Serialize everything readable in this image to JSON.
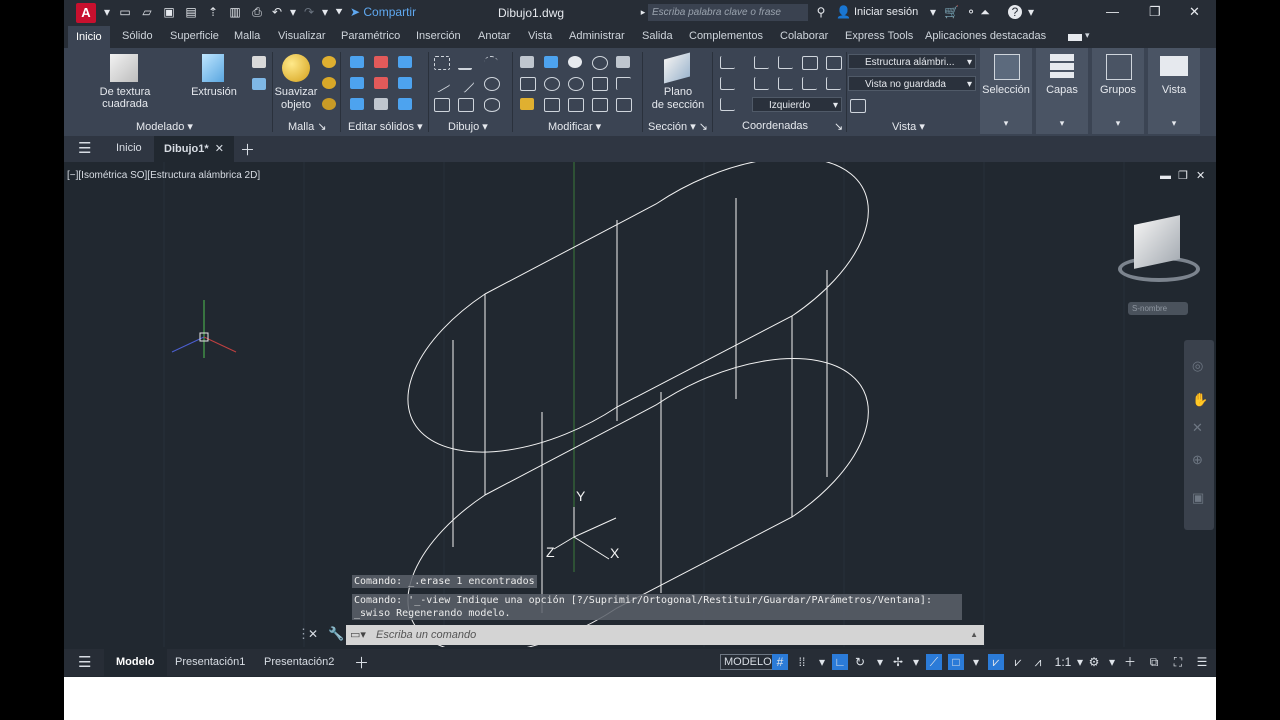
{
  "titlebar": {
    "logo": "A",
    "share_label": "Compartir",
    "doc_title": "Dibujo1.dwg",
    "search_placeholder": "Escriba palabra clave o frase",
    "signin_label": "Iniciar sesión"
  },
  "ribbon_tabs": [
    "Inicio",
    "Sólido",
    "Superficie",
    "Malla",
    "Visualizar",
    "Paramétrico",
    "Inserción",
    "Anotar",
    "Vista",
    "Administrar",
    "Salida",
    "Complementos",
    "Colaborar",
    "Express Tools",
    "Aplicaciones destacadas"
  ],
  "ribbon": {
    "big_buttons": {
      "box": "De textura cuadrada",
      "extrude": "Extrusión",
      "smooth_line1": "Suavizar",
      "smooth_line2": "objeto",
      "section_line1": "Plano",
      "section_line2": "de sección",
      "selection": "Selección",
      "layers": "Capas",
      "groups": "Grupos",
      "view": "Vista"
    },
    "panels": [
      "Modelado",
      "Malla",
      "Editar sólidos",
      "Dibujo",
      "Modificar",
      "Sección",
      "Coordenadas",
      "Vista"
    ],
    "coord_dropdown": "Izquierdo",
    "visual_style": "Estructura alámbri...",
    "named_view": "Vista no guardada"
  },
  "file_tabs": {
    "start": "Inicio",
    "active": "Dibujo1*"
  },
  "viewport": {
    "label": "[−][Isométrica SO][Estructura alámbrica 2D]",
    "viewcube_label": "S-nombre",
    "ucs_y": "Y",
    "ucs_x": "X",
    "ucs_z": "Z"
  },
  "command": {
    "history1": "Comando: _.erase 1 encontrados",
    "history2": "Comando: '_-view Indique una opción [?/Suprimir/Ortogonal/Restituir/Guardar/PArámetros/Ventana]:",
    "history3": "_swiso Regenerando modelo.",
    "placeholder": "Escriba un comando"
  },
  "status": {
    "model_tab": "Modelo",
    "layout1": "Presentación1",
    "layout2": "Presentación2",
    "model_button": "MODELO",
    "scale": "1:1"
  }
}
